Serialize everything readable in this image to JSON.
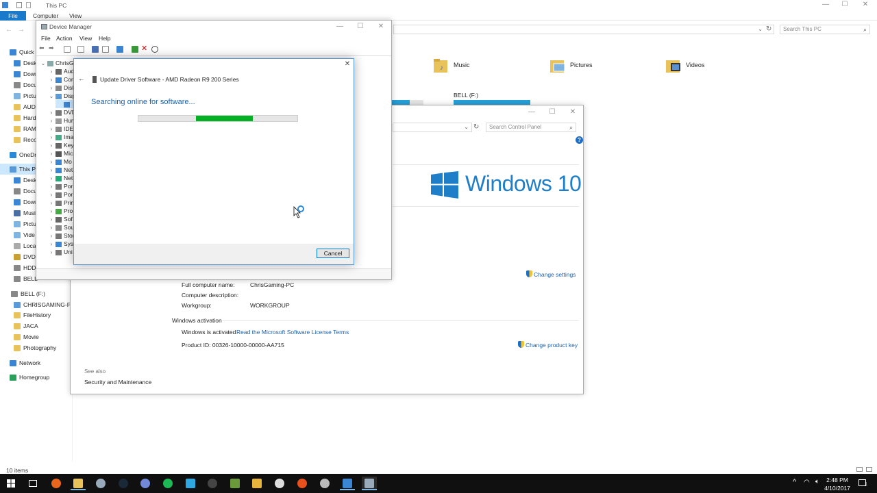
{
  "explorer": {
    "title": "This PC",
    "tabs": [
      "File",
      "Computer",
      "View"
    ],
    "search_placeholder": "Search This PC",
    "folders": [
      "Music",
      "Pictures",
      "Videos"
    ],
    "drive_label": "BELL (F:)",
    "status": "10 items",
    "nav": [
      "Quick",
      "Desk",
      "Down",
      "Docu",
      "Pictu",
      "AUD",
      "Hard",
      "RAM",
      "Reco",
      "OneDr",
      "This P",
      "Desk",
      "Docu",
      "Down",
      "Musi",
      "Pictu",
      "Vide",
      "Loca",
      "DVD",
      "HDD",
      "BELL",
      "BELL (F:)",
      "CHRISGAMING-PC",
      "FileHistory",
      "JACA",
      "Movie",
      "Photography",
      "Network",
      "Homegroup"
    ]
  },
  "devmgr": {
    "title": "Device Manager",
    "menu": [
      "File",
      "Action",
      "View",
      "Help"
    ],
    "root": "ChrisGa",
    "tree": [
      "Aud",
      "Com",
      "Disk",
      "Disp",
      "",
      "DVD",
      "Hum",
      "IDE",
      "Ima",
      "Key",
      "Mic",
      "Mo",
      "Net",
      "Net",
      "Por",
      "Por",
      "Prin",
      "Pro",
      "Sof",
      "Sou",
      "Stor",
      "Syst",
      "Uni"
    ]
  },
  "dialog": {
    "title": "Update Driver Software - AMD Radeon R9 200 Series",
    "heading": "Searching online for software...",
    "cancel": "Cancel",
    "progress_start": 0.36,
    "progress_end": 0.72
  },
  "system": {
    "search_placeholder": "Search Control Panel",
    "win_logo_text": "Windows 10",
    "change_settings": "Change settings",
    "full_name_label": "Full computer name:",
    "full_name_value": "ChrisGaming-PC",
    "description_label": "Computer description:",
    "workgroup_label": "Workgroup:",
    "workgroup_value": "WORKGROUP",
    "activation_heading": "Windows activation",
    "activated_text": "Windows is activated",
    "license_link": "Read the Microsoft Software License Terms",
    "product_id": "Product ID:  00326-10000-00000-AA715",
    "change_key": "Change product key",
    "see_also": "See also",
    "security": "Security and Maintenance"
  },
  "taskbar": {
    "time": "2:48 PM",
    "date": "4/10/2017",
    "notif_count": "1"
  },
  "colors": {
    "accent": "#1979ca",
    "progress": "#06b025",
    "win_blue": "#1e7ec8",
    "link": "#1c5fa8"
  }
}
